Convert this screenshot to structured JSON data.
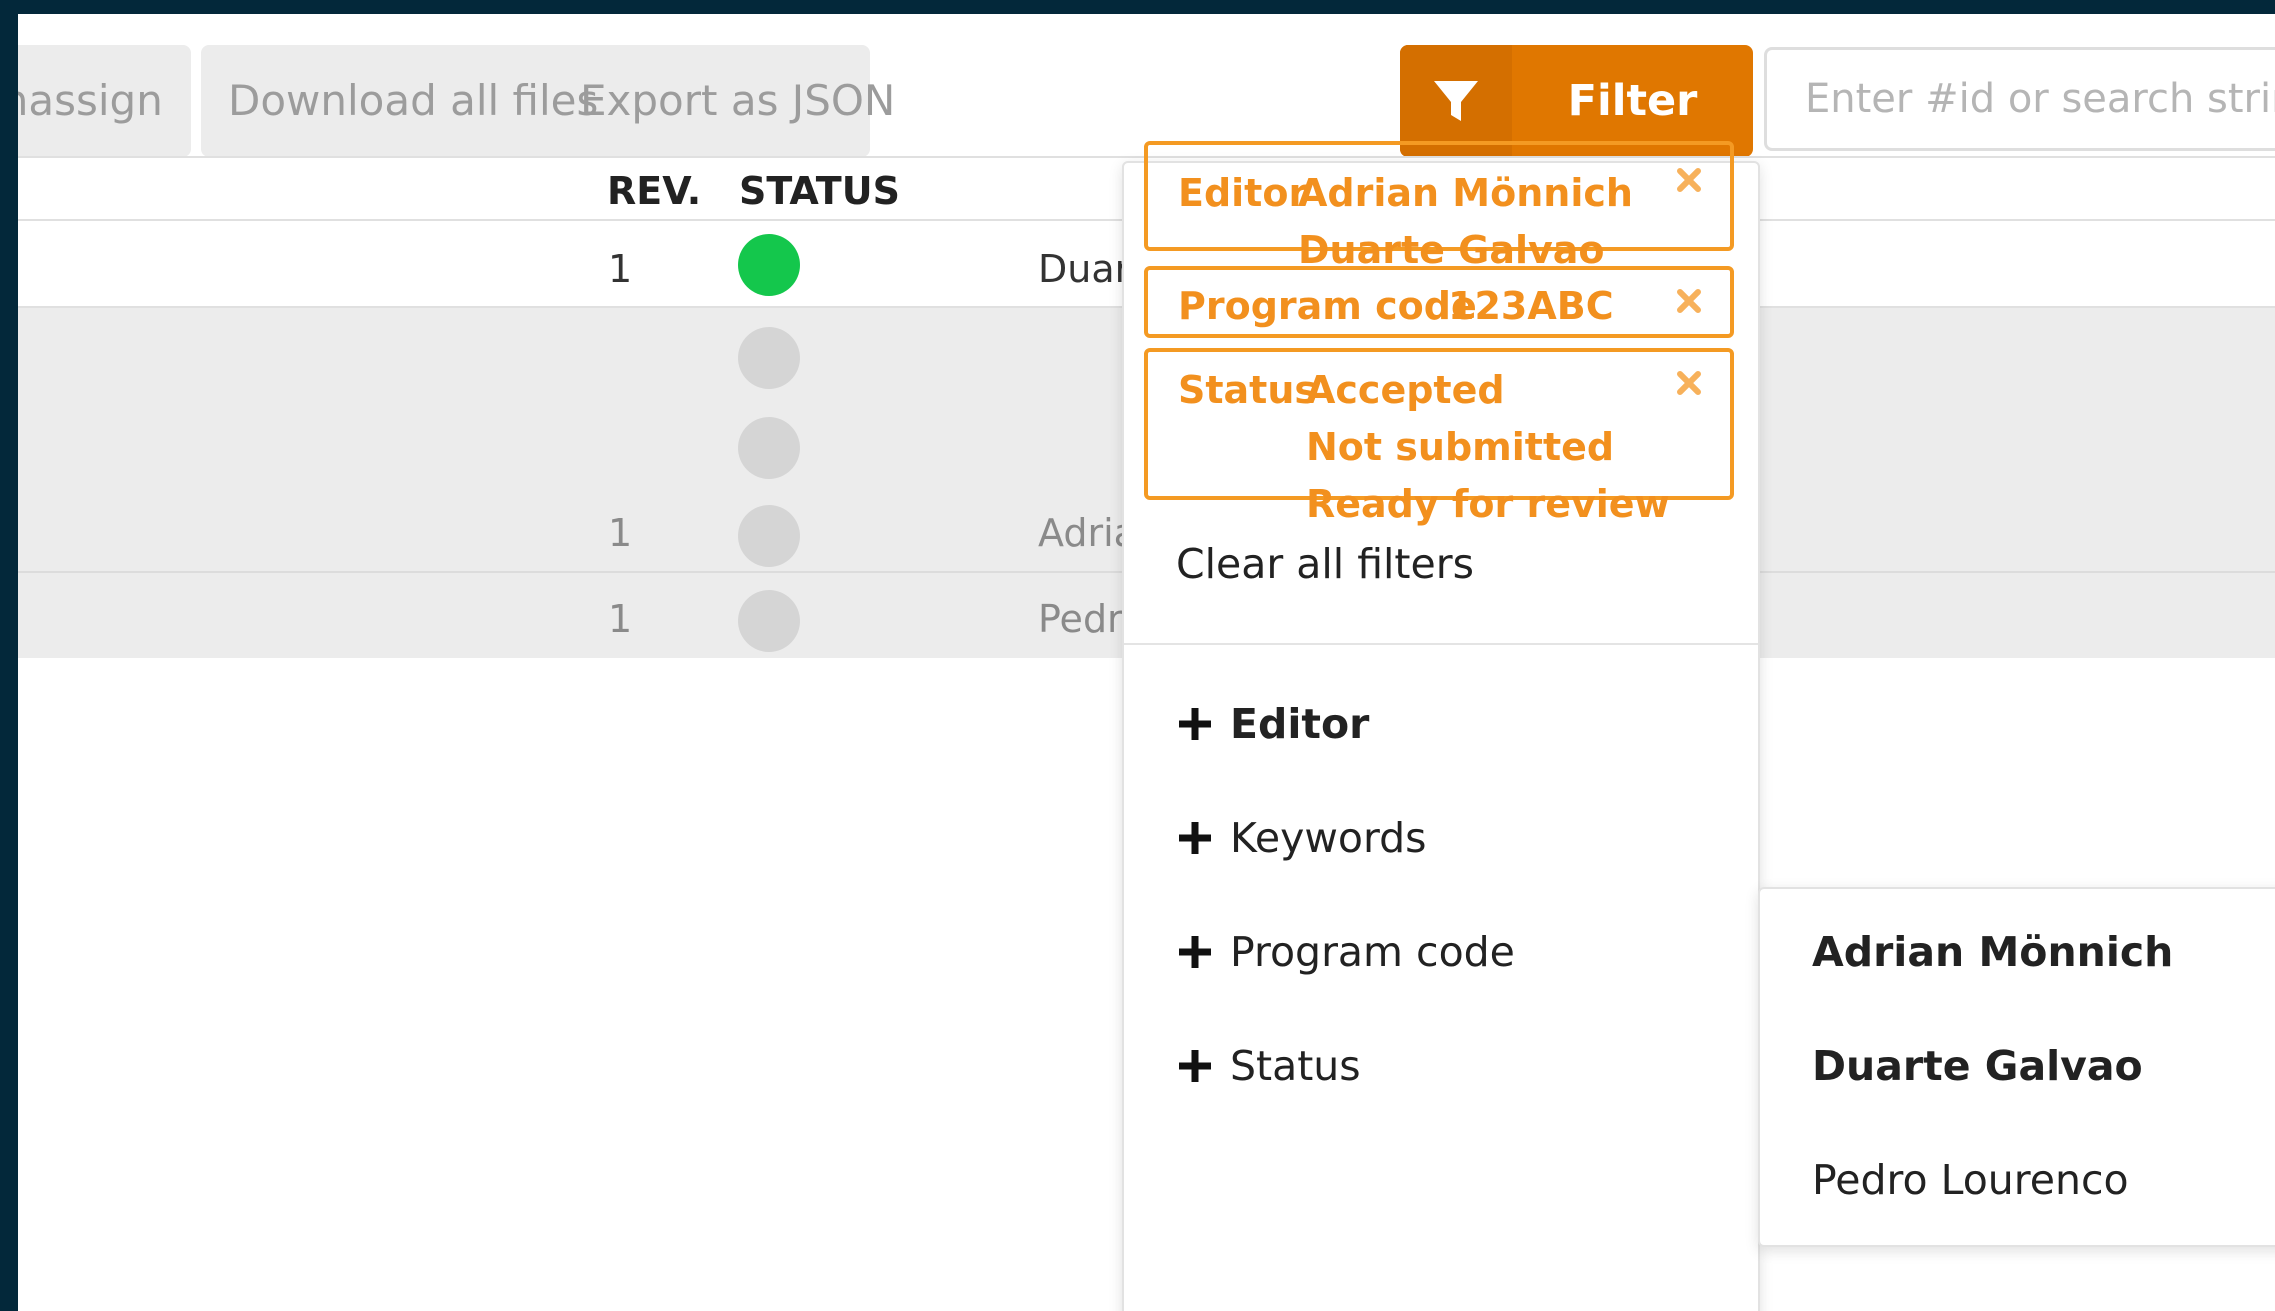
{
  "toolbar": {
    "unassign_label": "Unassign",
    "download_label": "Download all files",
    "export_label": "Export as JSON",
    "filter_label": "Filter",
    "search_placeholder": "Enter #id or search string"
  },
  "table": {
    "headers": {
      "rev": "REV.",
      "status": "STATUS"
    },
    "rows": [
      {
        "rev": "1",
        "status_color": "#14c74c",
        "editor": "Duarte Galvao",
        "highlight": false
      },
      {
        "rev": "",
        "status_color": "#d5d5d5",
        "editor": "",
        "highlight": true
      },
      {
        "rev": "",
        "status_color": "#d5d5d5",
        "editor": "",
        "highlight": true
      },
      {
        "rev": "1",
        "status_color": "#d5d5d5",
        "editor": "Adrian Mönnich",
        "highlight": true
      },
      {
        "rev": "1",
        "status_color": "#d5d5d5",
        "editor": "Pedro Lourenco",
        "highlight": true
      }
    ]
  },
  "filter_panel": {
    "active_filters": [
      {
        "key": "Editor",
        "values": [
          "Adrian Mönnich",
          "Duarte Galvao"
        ]
      },
      {
        "key": "Program code",
        "values": [
          "123ABC"
        ]
      },
      {
        "key": "Status",
        "values": [
          "Accepted",
          "Not submitted",
          "Ready for review"
        ]
      }
    ],
    "clear_label": "Clear all filters",
    "add_options": [
      "Editor",
      "Keywords",
      "Program code",
      "Status"
    ]
  },
  "editor_submenu": {
    "options": [
      {
        "label": "Adrian Mönnich",
        "selected": true
      },
      {
        "label": "Duarte Galvao",
        "selected": true
      },
      {
        "label": "Pedro Lourenco",
        "selected": false
      }
    ]
  },
  "colors": {
    "accent": "#e07700",
    "chip": "#f2901e",
    "frame": "#03283a"
  }
}
